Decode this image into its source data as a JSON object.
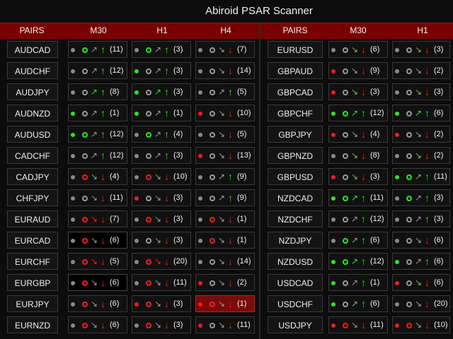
{
  "title": "Abiroid PSAR Scanner",
  "colors": {
    "green": "#27e627",
    "red": "#ff1a1a",
    "gray": "#8a8a8a",
    "header_bg": "#7a0000"
  },
  "left_headers": [
    "PAIRS",
    "M30",
    "H1",
    "H4"
  ],
  "right_headers": [
    "PAIRS",
    "M30",
    "H1"
  ],
  "left_rows": [
    {
      "pair": "AUDCAD",
      "cells": [
        [
          "gray",
          "green",
          "gray",
          "green",
          "(11)"
        ],
        [
          "gray",
          "green",
          "gray",
          "green",
          "(3)"
        ],
        [
          "gray",
          "gray",
          "gray",
          "red",
          "(7)"
        ]
      ]
    },
    {
      "pair": "AUDCHF",
      "cells": [
        [
          "gray",
          "gray",
          "gray",
          "green",
          "(12)"
        ],
        [
          "green",
          "gray",
          "gray",
          "green",
          "(3)"
        ],
        [
          "gray",
          "gray",
          "gray",
          "red",
          "(14)"
        ]
      ]
    },
    {
      "pair": "AUDJPY",
      "cells": [
        [
          "gray",
          "gray",
          "green",
          "green",
          "(8)"
        ],
        [
          "green",
          "gray",
          "green",
          "green",
          "(3)"
        ],
        [
          "gray",
          "gray",
          "gray",
          "green",
          "(5)"
        ]
      ]
    },
    {
      "pair": "AUDNZD",
      "cells": [
        [
          "green",
          "gray",
          "gray",
          "green",
          "(1)"
        ],
        [
          "green",
          "gray",
          "gray",
          "green",
          "(1)"
        ],
        [
          "red",
          "gray",
          "gray",
          "red",
          "(10)"
        ]
      ]
    },
    {
      "pair": "AUDUSD",
      "cells": [
        [
          "green",
          "green",
          "gray",
          "green",
          "(12)"
        ],
        [
          "gray",
          "green",
          "gray",
          "green",
          "(4)"
        ],
        [
          "gray",
          "gray",
          "gray",
          "red",
          "(5)"
        ]
      ]
    },
    {
      "pair": "CADCHF",
      "cells": [
        [
          "gray",
          "gray",
          "gray",
          "green",
          "(12)"
        ],
        [
          "gray",
          "gray",
          "gray",
          "green",
          "(3)"
        ],
        [
          "red",
          "gray",
          "gray",
          "red",
          "(13)"
        ]
      ]
    },
    {
      "pair": "CADJPY",
      "cells": [
        [
          "gray",
          "red",
          "gray",
          "red",
          "(4)"
        ],
        [
          "gray",
          "red",
          "gray",
          "red",
          "(10)"
        ],
        [
          "gray",
          "gray",
          "gray",
          "green",
          "(9)"
        ]
      ]
    },
    {
      "pair": "CHFJPY",
      "cells": [
        [
          "gray",
          "gray",
          "gray",
          "red",
          "(11)"
        ],
        [
          "red",
          "gray",
          "gray",
          "red",
          "(3)"
        ],
        [
          "gray",
          "gray",
          "gray",
          "green",
          "(9)"
        ]
      ]
    },
    {
      "pair": "EURAUD",
      "cells": [
        [
          "gray",
          "red",
          "red",
          "red",
          "(7)"
        ],
        [
          "gray",
          "red",
          "gray",
          "red",
          "(3)"
        ],
        [
          "gray",
          "red",
          "gray",
          "red",
          "(1)"
        ]
      ]
    },
    {
      "pair": "EURCAD",
      "black": 0,
      "cells": [
        [
          "gray",
          "red",
          "gray",
          "red",
          "(6)"
        ],
        [
          "gray",
          "gray",
          "gray",
          "red",
          "(3)"
        ],
        [
          "gray",
          "red",
          "gray",
          "red",
          "(1)"
        ]
      ]
    },
    {
      "pair": "EURCHF",
      "cells": [
        [
          "gray",
          "red",
          "red",
          "red",
          "(5)"
        ],
        [
          "gray",
          "red",
          "red",
          "red",
          "(20)"
        ],
        [
          "gray",
          "gray",
          "gray",
          "red",
          "(14)"
        ]
      ]
    },
    {
      "pair": "EURGBP",
      "black": 0,
      "cells": [
        [
          "gray",
          "red",
          "gray",
          "red",
          "(6)"
        ],
        [
          "gray",
          "red",
          "gray",
          "red",
          "(11)"
        ],
        [
          "red",
          "gray",
          "gray",
          "red",
          "(2)"
        ]
      ]
    },
    {
      "pair": "EURJPY",
      "hl": 2,
      "cells": [
        [
          "gray",
          "red",
          "gray",
          "red",
          "(6)"
        ],
        [
          "red",
          "red",
          "gray",
          "red",
          "(3)"
        ],
        [
          "red",
          "red",
          "gray",
          "red",
          "(1)"
        ]
      ]
    },
    {
      "pair": "EURNZD",
      "cells": [
        [
          "gray",
          "red",
          "gray",
          "red",
          "(6)"
        ],
        [
          "gray",
          "red",
          "gray",
          "red",
          "(3)"
        ],
        [
          "red",
          "gray",
          "gray",
          "red",
          "(11)"
        ]
      ]
    }
  ],
  "right_rows": [
    {
      "pair": "EURUSD",
      "cells": [
        [
          "gray",
          "gray",
          "gray",
          "red",
          "(6)"
        ],
        [
          "gray",
          "gray",
          "gray",
          "red",
          "(3)"
        ]
      ]
    },
    {
      "pair": "GBPAUD",
      "cells": [
        [
          "red",
          "gray",
          "gray",
          "red",
          "(9)"
        ],
        [
          "gray",
          "gray",
          "gray",
          "red",
          "(2)"
        ]
      ]
    },
    {
      "pair": "GBPCAD",
      "cells": [
        [
          "red",
          "gray",
          "gray",
          "red",
          "(3)"
        ],
        [
          "gray",
          "gray",
          "gray",
          "red",
          "(3)"
        ]
      ]
    },
    {
      "pair": "GBPCHF",
      "cells": [
        [
          "green",
          "green",
          "green",
          "green",
          "(12)"
        ],
        [
          "green",
          "gray",
          "green",
          "green",
          "(6)"
        ]
      ]
    },
    {
      "pair": "GBPJPY",
      "cells": [
        [
          "red",
          "gray",
          "gray",
          "red",
          "(4)"
        ],
        [
          "red",
          "gray",
          "gray",
          "red",
          "(2)"
        ]
      ]
    },
    {
      "pair": "GBPNZD",
      "cells": [
        [
          "gray",
          "gray",
          "gray",
          "red",
          "(8)"
        ],
        [
          "gray",
          "gray",
          "gray",
          "red",
          "(2)"
        ]
      ]
    },
    {
      "pair": "GBPUSD",
      "cells": [
        [
          "red",
          "gray",
          "gray",
          "red",
          "(3)"
        ],
        [
          "green",
          "green",
          "gray",
          "green",
          "(11)"
        ]
      ]
    },
    {
      "pair": "NZDCAD",
      "cells": [
        [
          "green",
          "green",
          "green",
          "green",
          "(11)"
        ],
        [
          "gray",
          "green",
          "gray",
          "green",
          "(3)"
        ]
      ]
    },
    {
      "pair": "NZDCHF",
      "cells": [
        [
          "gray",
          "gray",
          "gray",
          "green",
          "(12)"
        ],
        [
          "gray",
          "gray",
          "gray",
          "green",
          "(3)"
        ]
      ]
    },
    {
      "pair": "NZDJPY",
      "cells": [
        [
          "gray",
          "green",
          "gray",
          "green",
          "(6)"
        ],
        [
          "gray",
          "gray",
          "gray",
          "red",
          "(6)"
        ]
      ]
    },
    {
      "pair": "NZDUSD",
      "cells": [
        [
          "green",
          "green",
          "green",
          "green",
          "(12)"
        ],
        [
          "green",
          "gray",
          "gray",
          "green",
          "(6)"
        ]
      ]
    },
    {
      "pair": "USDCAD",
      "cells": [
        [
          "green",
          "gray",
          "gray",
          "green",
          "(1)"
        ],
        [
          "red",
          "gray",
          "gray",
          "red",
          "(6)"
        ]
      ]
    },
    {
      "pair": "USDCHF",
      "cells": [
        [
          "green",
          "gray",
          "gray",
          "green",
          "(6)"
        ],
        [
          "gray",
          "gray",
          "gray",
          "red",
          "(20)"
        ]
      ]
    },
    {
      "pair": "USDJPY",
      "cells": [
        [
          "red",
          "red",
          "gray",
          "red",
          "(11)"
        ],
        [
          "red",
          "red",
          "gray",
          "red",
          "(10)"
        ]
      ]
    }
  ]
}
